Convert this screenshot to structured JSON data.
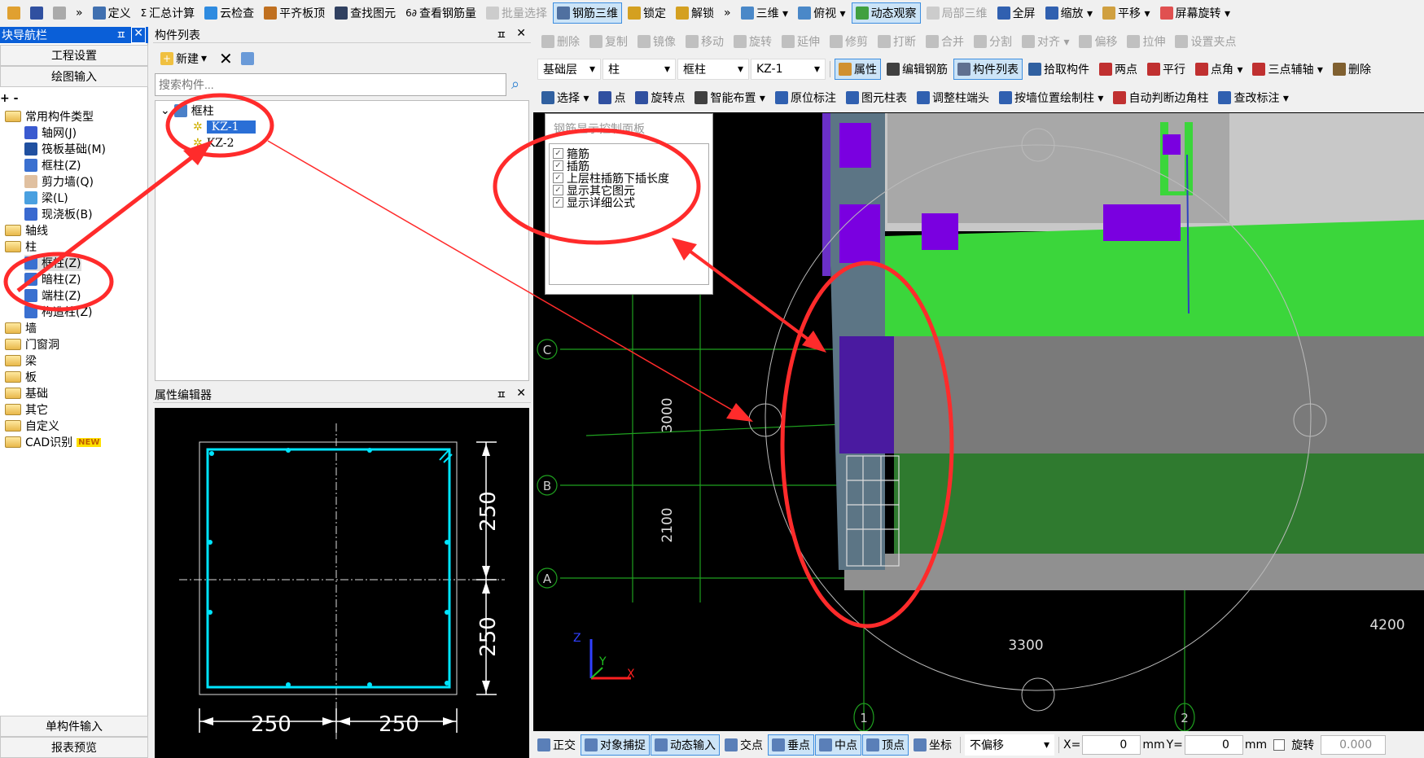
{
  "toolbar_main": [
    {
      "label": "",
      "icon": "open-folder-icon",
      "color": "#e0a030"
    },
    {
      "label": "",
      "icon": "save-icon",
      "color": "#3050a0"
    },
    {
      "label": "",
      "icon": "undo-icon",
      "color": "#aaaaaa",
      "state": "disabled"
    },
    {
      "label": "»",
      "icon": ""
    },
    {
      "label": "定义",
      "icon": "define-icon",
      "color": "#4070b0"
    },
    {
      "label": "汇总计算",
      "icon": "sigma-icon",
      "glyph": "Σ"
    },
    {
      "label": "云检查",
      "icon": "cloud-check-icon",
      "color": "#2e8be0"
    },
    {
      "label": "平齐板顶",
      "icon": "align-slab-icon",
      "color": "#c07020"
    },
    {
      "label": "查找图元",
      "icon": "binoculars-icon",
      "color": "#304060"
    },
    {
      "label": "查看钢筋量",
      "icon": "rebar-quantity-icon",
      "glyph": "6∂"
    },
    {
      "label": "批量选择",
      "icon": "batch-select-icon",
      "color": "#cccccc",
      "state": "disabled"
    },
    {
      "label": "钢筋三维",
      "icon": "rebar-3d-icon",
      "color": "#5070a0",
      "state": "active"
    },
    {
      "label": "锁定",
      "icon": "lock-icon",
      "color": "#d4a020"
    },
    {
      "label": "解锁",
      "icon": "unlock-icon",
      "color": "#d4a020"
    },
    {
      "label": "»",
      "icon": ""
    },
    {
      "label": "三维 ▾",
      "icon": "cube-3d-icon",
      "color": "#4a88c8"
    },
    {
      "label": "俯视 ▾",
      "icon": "top-view-icon",
      "color": "#4a88c8"
    },
    {
      "label": "动态观察",
      "icon": "orbit-icon",
      "color": "#40a040",
      "state": "active"
    },
    {
      "label": "局部三维",
      "icon": "partial-3d-icon",
      "color": "#cccccc",
      "state": "disabled"
    },
    {
      "label": "全屏",
      "icon": "zoom-extents-icon",
      "color": "#3060b0"
    },
    {
      "label": "缩放 ▾",
      "icon": "zoom-icon",
      "color": "#3060b0"
    },
    {
      "label": "平移 ▾",
      "icon": "pan-hand-icon",
      "color": "#d0a040"
    },
    {
      "label": "屏幕旋转 ▾",
      "icon": "screen-rotate-icon",
      "color": "#e05050"
    }
  ],
  "toolbar_edit": [
    {
      "label": "删除",
      "icon": "delete-icon"
    },
    {
      "label": "复制",
      "icon": "copy-icon"
    },
    {
      "label": "镜像",
      "icon": "mirror-icon"
    },
    {
      "label": "移动",
      "icon": "move-icon"
    },
    {
      "label": "旋转",
      "icon": "rotate-icon"
    },
    {
      "label": "延伸",
      "icon": "extend-icon"
    },
    {
      "label": "修剪",
      "icon": "trim-icon"
    },
    {
      "label": "打断",
      "icon": "break-icon"
    },
    {
      "label": "合并",
      "icon": "merge-icon"
    },
    {
      "label": "分割",
      "icon": "split-icon"
    },
    {
      "label": "对齐 ▾",
      "icon": "align-icon"
    },
    {
      "label": "偏移",
      "icon": "offset-icon"
    },
    {
      "label": "拉伸",
      "icon": "stretch-icon"
    },
    {
      "label": "设置夹点",
      "icon": "grip-point-icon"
    }
  ],
  "selectors": {
    "floor": "基础层",
    "category": "柱",
    "type": "框柱",
    "component": "KZ-1"
  },
  "toolbar_component": [
    {
      "label": "属性",
      "icon": "properties-icon",
      "color": "#d09030",
      "state": "active"
    },
    {
      "label": "编辑钢筋",
      "icon": "edit-rebar-icon",
      "color": "#404040"
    },
    {
      "label": "构件列表",
      "icon": "component-list-icon",
      "color": "#607090",
      "state": "active"
    },
    {
      "label": "拾取构件",
      "icon": "eyedropper-icon",
      "color": "#3060a0"
    },
    {
      "label": "两点",
      "icon": "two-point-axis-icon",
      "color": "#c03030"
    },
    {
      "label": "平行",
      "icon": "parallel-axis-icon",
      "color": "#c03030"
    },
    {
      "label": "点角 ▾",
      "icon": "point-angle-icon",
      "color": "#c03030"
    },
    {
      "label": "三点辅轴 ▾",
      "icon": "three-point-axis-icon",
      "color": "#c03030"
    },
    {
      "label": "删除",
      "icon": "delete-axis-icon",
      "color": "#806030"
    }
  ],
  "toolbar_draw": [
    {
      "label": "选择 ▾",
      "icon": "cursor-icon",
      "color": "#3060a0"
    },
    {
      "label": "点",
      "icon": "point-icon",
      "color": "#3050a0"
    },
    {
      "label": "旋转点",
      "icon": "rotate-point-icon",
      "color": "#3050a0"
    },
    {
      "label": "智能布置 ▾",
      "icon": "smart-layout-icon",
      "color": "#404040"
    },
    {
      "label": "原位标注",
      "icon": "in-place-label-icon",
      "color": "#3060b0"
    },
    {
      "label": "图元柱表",
      "icon": "column-table-icon",
      "color": "#3060b0"
    },
    {
      "label": "调整柱端头",
      "icon": "adjust-column-end-icon",
      "color": "#3060b0"
    },
    {
      "label": "按墙位置绘制柱 ▾",
      "icon": "draw-column-by-wall-icon",
      "color": "#3060b0"
    },
    {
      "label": "自动判断边角柱",
      "icon": "auto-corner-column-icon",
      "color": "#c03030"
    },
    {
      "label": "查改标注 ▾",
      "icon": "check-label-icon",
      "color": "#3060b0"
    }
  ],
  "nav": {
    "title": "块导航栏",
    "btn_settings": "工程设置",
    "btn_drawing": "绘图输入",
    "tree": [
      {
        "label": "常用构件类型",
        "kind": "folder-open",
        "level": 0
      },
      {
        "label": "轴网(J)",
        "kind": "grid",
        "level": 1
      },
      {
        "label": "筏板基础(M)",
        "kind": "raft",
        "level": 1
      },
      {
        "label": "框柱(Z)",
        "kind": "column",
        "level": 1
      },
      {
        "label": "剪力墙(Q)",
        "kind": "wall",
        "level": 1
      },
      {
        "label": "梁(L)",
        "kind": "beam",
        "level": 1
      },
      {
        "label": "现浇板(B)",
        "kind": "slab",
        "level": 1
      },
      {
        "label": "轴线",
        "kind": "folder",
        "level": 0
      },
      {
        "label": "柱",
        "kind": "folder-open",
        "level": 0
      },
      {
        "label": "框柱(Z)",
        "kind": "column",
        "level": 1,
        "selected": true
      },
      {
        "label": "暗柱(Z)",
        "kind": "column",
        "level": 1
      },
      {
        "label": "端柱(Z)",
        "kind": "column",
        "level": 1
      },
      {
        "label": "构造柱(Z)",
        "kind": "constructional",
        "level": 1
      },
      {
        "label": "墙",
        "kind": "folder",
        "level": 0
      },
      {
        "label": "门窗洞",
        "kind": "folder",
        "level": 0
      },
      {
        "label": "梁",
        "kind": "folder",
        "level": 0
      },
      {
        "label": "板",
        "kind": "folder",
        "level": 0
      },
      {
        "label": "基础",
        "kind": "folder",
        "level": 0
      },
      {
        "label": "其它",
        "kind": "folder",
        "level": 0
      },
      {
        "label": "自定义",
        "kind": "folder",
        "level": 0
      },
      {
        "label": "CAD识别",
        "kind": "folder",
        "level": 0,
        "badge": "NEW"
      }
    ],
    "btn_single": "单构件输入",
    "btn_report": "报表预览"
  },
  "component_list": {
    "title": "构件列表",
    "new_label": "新建",
    "search_placeholder": "搜索构件...",
    "root": "框柱",
    "items": [
      {
        "label": "KZ-1",
        "selected": true
      },
      {
        "label": "KZ-2"
      }
    ]
  },
  "property_editor": {
    "title": "属性编辑器",
    "dims": {
      "right_top": "250",
      "right_bottom": "250",
      "bottom_left": "250",
      "bottom_right": "250"
    }
  },
  "rebar_panel": {
    "title": "钢筋显示控制面板",
    "options": [
      {
        "label": "箍筋",
        "checked": true
      },
      {
        "label": "插筋",
        "checked": true
      },
      {
        "label": "上层柱插筋下插长度",
        "checked": true
      },
      {
        "label": "显示其它图元",
        "checked": true
      },
      {
        "label": "显示详细公式",
        "checked": true
      }
    ]
  },
  "viewport": {
    "axis_rows": [
      "C",
      "B",
      "A"
    ],
    "axis_cols": [
      "1",
      "2"
    ],
    "dims": {
      "v1": "3000",
      "v2": "2100",
      "h1": "3300",
      "h2": "4200"
    },
    "axes": {
      "x": "X",
      "y": "Y",
      "z": "Z"
    }
  },
  "status": {
    "items": [
      {
        "label": "正交",
        "icon": "ortho-icon"
      },
      {
        "label": "对象捕捉",
        "icon": "object-snap-icon",
        "state": "active"
      },
      {
        "label": "动态输入",
        "icon": "dynamic-input-icon",
        "state": "active"
      },
      {
        "label": "交点",
        "icon": "intersection-icon"
      },
      {
        "label": "垂点",
        "icon": "perpendicular-icon",
        "state": "active"
      },
      {
        "label": "中点",
        "icon": "midpoint-icon",
        "state": "active"
      },
      {
        "label": "顶点",
        "icon": "vertex-icon",
        "state": "active"
      },
      {
        "label": "坐标",
        "icon": "coordinate-icon"
      }
    ],
    "offset_mode": "不偏移",
    "x_label": "X=",
    "x_value": "0",
    "mm1": "mm",
    "y_label": "Y=",
    "y_value": "0",
    "mm2": "mm",
    "rotate_label": "旋转",
    "rotate_value": "0.000",
    "rotate_checked": false
  },
  "colors": {
    "accent": "#3d8ee0",
    "title_blue": "#0a5fd8",
    "annotation": "#ff2b2b",
    "rebar": "#00e5ff",
    "grid": "#1fa01f"
  }
}
